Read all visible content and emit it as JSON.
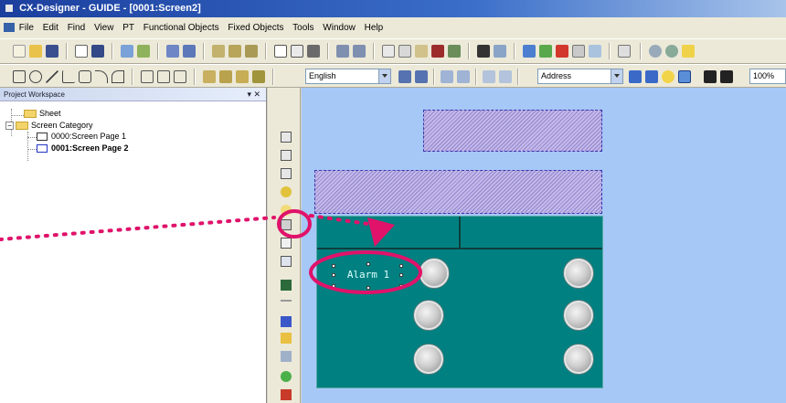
{
  "window": {
    "title": "CX-Designer - GUIDE - [0001:Screen2]"
  },
  "menu": [
    "File",
    "Edit",
    "Find",
    "View",
    "PT",
    "Functional Objects",
    "Fixed Objects",
    "Tools",
    "Window",
    "Help"
  ],
  "toolbar2": {
    "language_value": "English",
    "address_value": "Address",
    "zoom_value": "100%"
  },
  "workspace": {
    "title": "Project Workspace",
    "tree": {
      "sheet": "Sheet",
      "category": "Screen Category",
      "page1": "0000:Screen Page 1",
      "page2": "0001:Screen Page 2"
    }
  },
  "canvas": {
    "alarm_label": "Alarm 1"
  },
  "colors": {
    "canvas_bg": "#a5c8f7",
    "panel_bg": "#008080",
    "highlight": "#e0126a"
  }
}
